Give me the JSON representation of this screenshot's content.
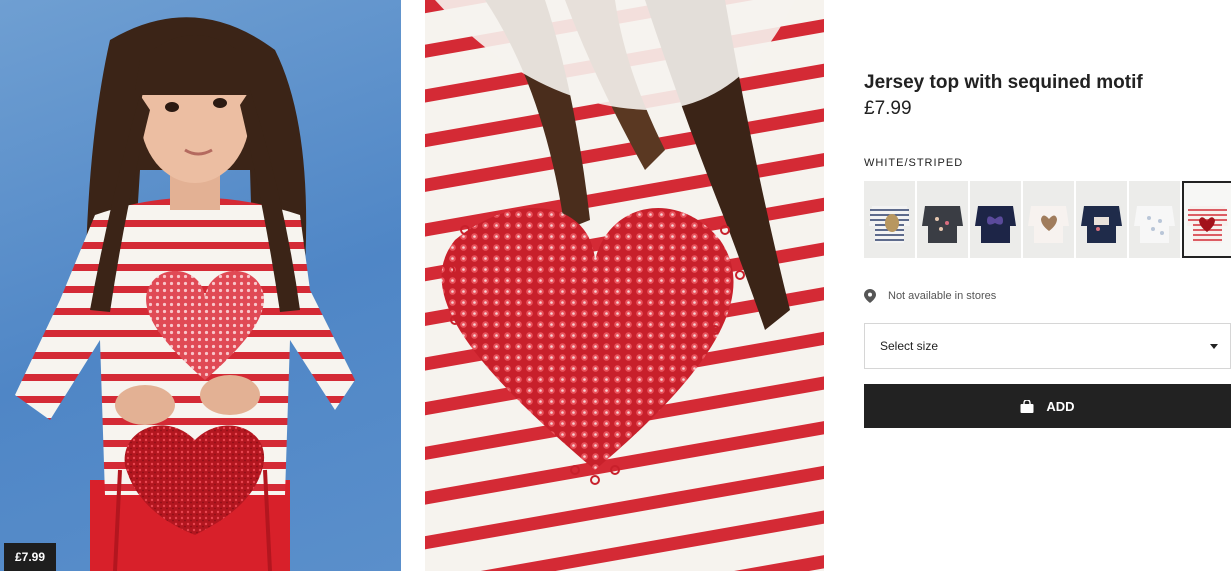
{
  "gallery": {
    "photo_1_alt": "Girl wearing striped top with sequined heart",
    "photo_2_alt": "Close-up of sequined heart motif",
    "price_badge": "£7.99"
  },
  "product": {
    "title": "Jersey top with sequined motif",
    "price": "£7.99",
    "color_label": "WHITE/STRIPED",
    "availability": "Not available in stores",
    "size_placeholder": "Select size",
    "add_label": "ADD"
  },
  "swatches": [
    {
      "name": "blue-striped-sequin-animal",
      "selected": false
    },
    {
      "name": "dark-grey-print",
      "selected": false
    },
    {
      "name": "navy-sequin-butterfly",
      "selected": false
    },
    {
      "name": "white-sequin-heart-gold",
      "selected": false
    },
    {
      "name": "navy-print",
      "selected": false
    },
    {
      "name": "white-snowflake",
      "selected": false
    },
    {
      "name": "white-striped-red-heart",
      "selected": true
    }
  ],
  "colors": {
    "stripe_red": "#d42a35",
    "background_blue": "#5b8fcb",
    "button_dark": "#222222"
  },
  "icons": {
    "location": "location-pin-icon",
    "bag": "shopping-bag-icon",
    "caret": "chevron-down-icon"
  }
}
